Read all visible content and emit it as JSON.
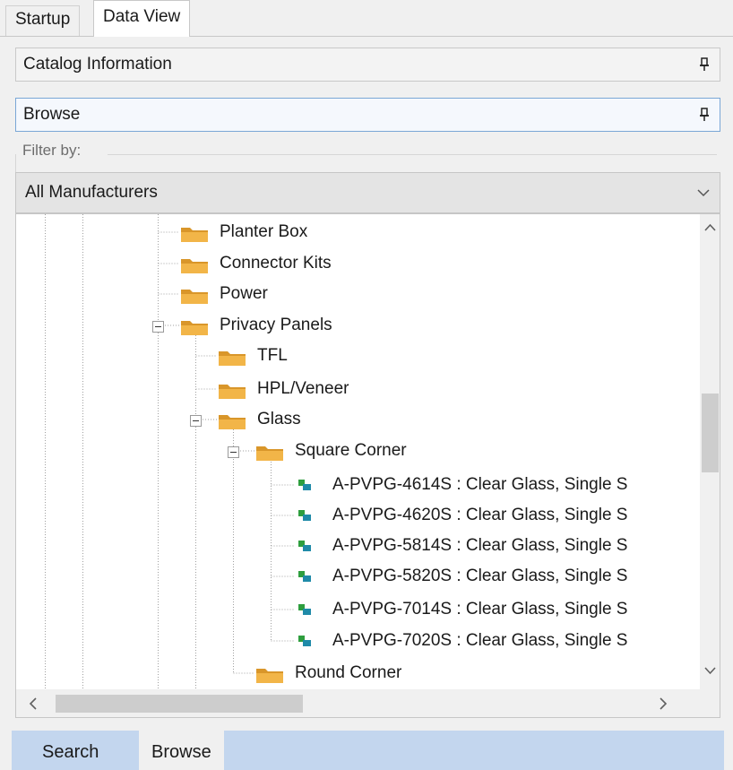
{
  "top_tabs": [
    {
      "label": "Startup",
      "active": false
    },
    {
      "label": "Data View",
      "active": true
    }
  ],
  "panels": {
    "catalog_info": "Catalog Information",
    "browse": "Browse"
  },
  "filter": {
    "label": "Filter by:",
    "selected": "All Manufacturers"
  },
  "tree": {
    "nodes": [
      {
        "label": "Planter Box",
        "type": "folder"
      },
      {
        "label": "Connector Kits",
        "type": "folder"
      },
      {
        "label": "Power",
        "type": "folder"
      },
      {
        "label": "Privacy Panels",
        "type": "folder",
        "expanded": true
      },
      {
        "label": "TFL",
        "type": "folder"
      },
      {
        "label": "HPL/Veneer",
        "type": "folder"
      },
      {
        "label": "Glass",
        "type": "folder",
        "expanded": true
      },
      {
        "label": "Square Corner",
        "type": "folder",
        "expanded": true
      },
      {
        "label": "A-PVPG-4614S : Clear Glass, Single S",
        "type": "item"
      },
      {
        "label": "A-PVPG-4620S : Clear Glass, Single S",
        "type": "item"
      },
      {
        "label": "A-PVPG-5814S : Clear Glass, Single S",
        "type": "item"
      },
      {
        "label": "A-PVPG-5820S : Clear Glass, Single S",
        "type": "item"
      },
      {
        "label": "A-PVPG-7014S : Clear Glass, Single S",
        "type": "item"
      },
      {
        "label": "A-PVPG-7020S : Clear Glass, Single S",
        "type": "item"
      },
      {
        "label": "Round Corner",
        "type": "folder"
      }
    ]
  },
  "bottom_tabs": [
    {
      "label": "Search",
      "active": false
    },
    {
      "label": "Browse",
      "active": true
    }
  ],
  "colors": {
    "folder": "#f2b548",
    "folder_dark": "#d9962a",
    "item_green": "#2e9e3e",
    "item_teal": "#1f8aa8",
    "bottom_bar": "#c3d6ee",
    "active_panel_border": "#7aa7d6"
  },
  "icons": {
    "pin": "pin-icon",
    "combo_arrow": "chevron-down-icon",
    "scroll_up": "chevron-up-icon",
    "scroll_down": "chevron-down-icon",
    "scroll_left": "chevron-left-icon",
    "scroll_right": "chevron-right-icon",
    "folder": "folder-icon",
    "item": "catalog-item-icon"
  }
}
